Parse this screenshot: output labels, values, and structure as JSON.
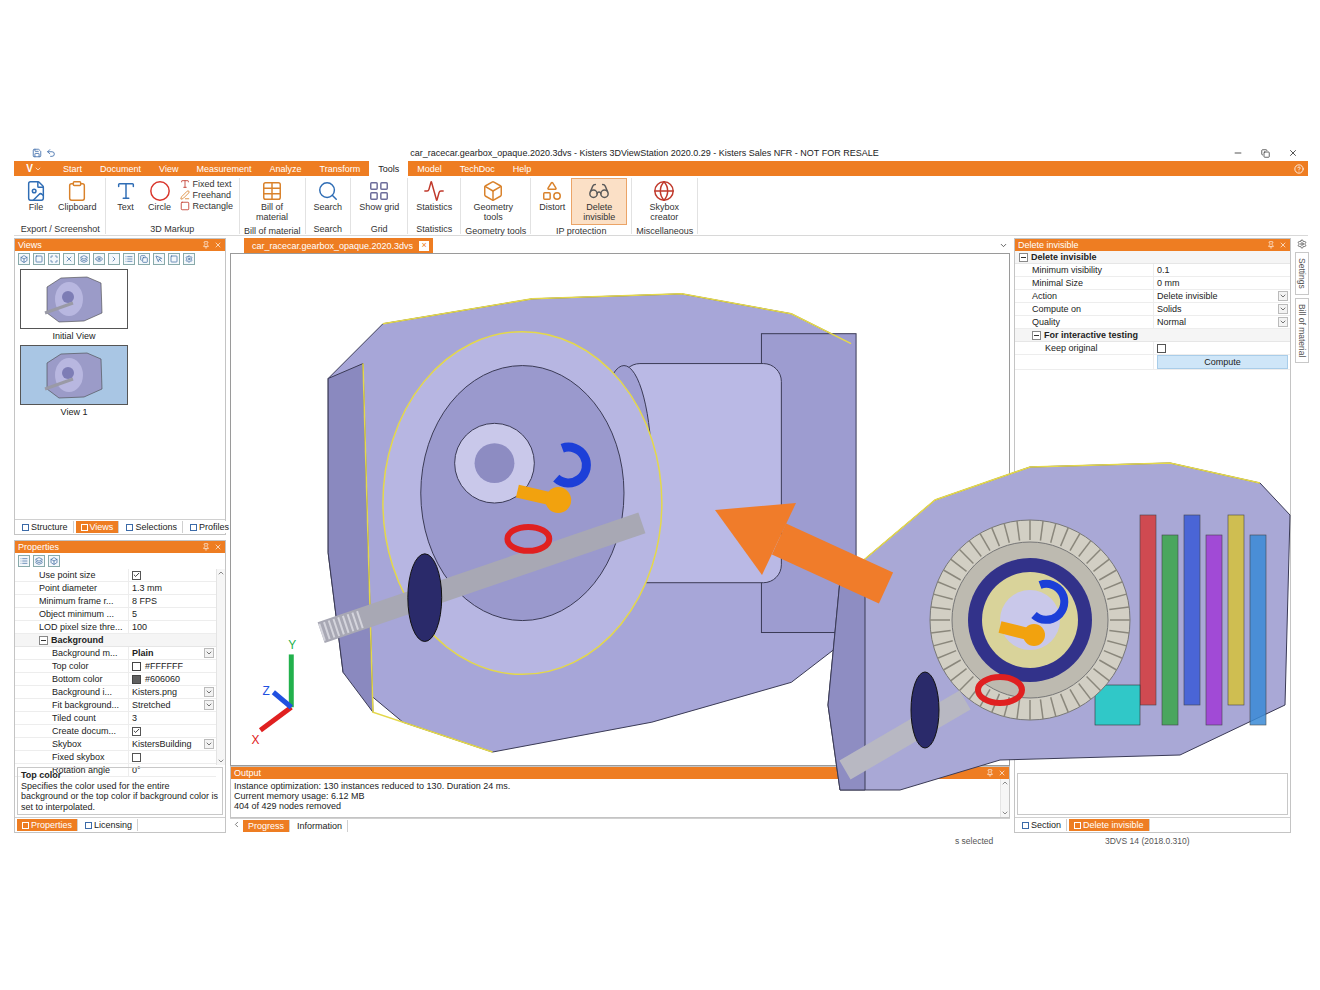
{
  "window": {
    "title": "car_racecar.gearbox_opaque.2020.3dvs - Kisters 3DViewStation 2020.0.29 - Kisters Sales NFR - NOT FOR RESALE"
  },
  "menu": {
    "app_button": "V",
    "tabs": [
      {
        "label": "Start",
        "selected": false
      },
      {
        "label": "Document",
        "selected": false
      },
      {
        "label": "View",
        "selected": false
      },
      {
        "label": "Measurement",
        "selected": false
      },
      {
        "label": "Analyze",
        "selected": false
      },
      {
        "label": "Transform",
        "selected": false
      },
      {
        "label": "Tools",
        "selected": true
      },
      {
        "label": "Model",
        "selected": false
      },
      {
        "label": "TechDoc",
        "selected": false
      },
      {
        "label": "Help",
        "selected": false
      }
    ]
  },
  "ribbon": {
    "groups": [
      {
        "label": "Export / Screenshot",
        "buttons": [
          {
            "label": "File",
            "kind": "large",
            "selected": false
          },
          {
            "label": "Clipboard",
            "kind": "large",
            "selected": false
          }
        ]
      },
      {
        "label": "3D Markup",
        "buttons": [
          {
            "label": "Text",
            "kind": "large",
            "selected": false
          },
          {
            "label": "Circle",
            "kind": "large",
            "selected": false
          },
          {
            "label": "Fixed text",
            "kind": "small",
            "selected": false
          },
          {
            "label": "Freehand",
            "kind": "small",
            "selected": false
          },
          {
            "label": "Rectangle",
            "kind": "small",
            "selected": false
          }
        ]
      },
      {
        "label": "Bill of material",
        "buttons": [
          {
            "label": "Bill of material",
            "kind": "large",
            "selected": false
          }
        ]
      },
      {
        "label": "Search",
        "buttons": [
          {
            "label": "Search",
            "kind": "large",
            "selected": false
          }
        ]
      },
      {
        "label": "Grid",
        "buttons": [
          {
            "label": "Show grid",
            "kind": "large",
            "selected": false
          }
        ]
      },
      {
        "label": "Statistics",
        "buttons": [
          {
            "label": "Statistics",
            "kind": "large",
            "selected": false
          }
        ]
      },
      {
        "label": "Geometry tools",
        "buttons": [
          {
            "label": "Geometry tools",
            "kind": "large",
            "selected": false
          }
        ]
      },
      {
        "label": "IP protection",
        "buttons": [
          {
            "label": "Distort",
            "kind": "large",
            "selected": false
          },
          {
            "label": "Delete invisible",
            "kind": "large",
            "selected": true
          }
        ]
      },
      {
        "label": "Miscellaneous",
        "buttons": [
          {
            "label": "Skybox creator",
            "kind": "large",
            "selected": false
          }
        ]
      }
    ]
  },
  "views_panel": {
    "title": "Views",
    "thumbnails": [
      {
        "label": "Initial View",
        "selected": false
      },
      {
        "label": "View 1",
        "selected": true
      }
    ],
    "tabs": [
      {
        "label": "Structure",
        "selected": false
      },
      {
        "label": "Views",
        "selected": true
      },
      {
        "label": "Selections",
        "selected": false
      },
      {
        "label": "Profiles",
        "selected": false
      }
    ]
  },
  "properties_panel": {
    "title": "Properties",
    "rows": [
      {
        "kind": "checkbox",
        "label": "Use point size",
        "checked": true
      },
      {
        "kind": "text",
        "label": "Point diameter",
        "value": "1.3 mm"
      },
      {
        "kind": "text",
        "label": "Minimum frame r...",
        "value": "8 FPS"
      },
      {
        "kind": "text",
        "label": "Object minimum ...",
        "value": "5"
      },
      {
        "kind": "text",
        "label": "LOD pixel size thre...",
        "value": "100"
      },
      {
        "kind": "group",
        "label": "Background",
        "expanded": true,
        "children": [
          {
            "kind": "dropdown",
            "label": "Background m...",
            "value": "Plain",
            "modified": true
          },
          {
            "kind": "color",
            "label": "Top color",
            "value": "#FFFFFF",
            "color": "#ffffff"
          },
          {
            "kind": "color",
            "label": "Bottom color",
            "value": "#606060",
            "color": "#606060"
          },
          {
            "kind": "dropdown",
            "label": "Background i...",
            "value": "Kisters.png",
            "modified": false
          },
          {
            "kind": "dropdown",
            "label": "Fit background...",
            "value": "Stretched",
            "modified": false
          },
          {
            "kind": "text",
            "label": "Tiled count",
            "value": "3"
          },
          {
            "kind": "checkbox",
            "label": "Create docum...",
            "checked": true
          },
          {
            "kind": "dropdown",
            "label": "Skybox",
            "value": "KistersBuilding",
            "modified": false
          },
          {
            "kind": "checkbox",
            "label": "Fixed skybox",
            "checked": false
          },
          {
            "kind": "text",
            "label": "Rotation angle",
            "value": "0°"
          }
        ]
      }
    ],
    "description": {
      "title": "Top color",
      "text": "Specifies the color used for the entire background or the top color if background color is set to interpolated."
    },
    "tabs": [
      {
        "label": "Properties",
        "selected": true
      },
      {
        "label": "Licensing",
        "selected": false
      }
    ]
  },
  "document": {
    "tab": "car_racecar.gearbox_opaque.2020.3dvs",
    "close": "×"
  },
  "axes": [
    {
      "label": "X",
      "color": "#e02020"
    },
    {
      "label": "Y",
      "color": "#22b14c"
    },
    {
      "label": "Z",
      "color": "#2050e0"
    }
  ],
  "output": {
    "title": "Output",
    "lines": [
      "Instance optimization: 130 instances reduced to 130. Duration 24 ms.",
      "Current memory usage: 6.12 MB",
      "404 of 429 nodes removed"
    ],
    "tabs": [
      {
        "label": "Progress",
        "selected": true
      },
      {
        "label": "Information",
        "selected": false
      }
    ]
  },
  "status_bar": {
    "selection": "s selected",
    "version": "3DVS 14 (2018.0.310)"
  },
  "delete_panel": {
    "title": "Delete invisible",
    "rows": [
      {
        "kind": "group",
        "label": "Delete invisible",
        "expanded": true,
        "children": [
          {
            "kind": "text",
            "label": "Minimum visibility",
            "value": "0.1"
          },
          {
            "kind": "text",
            "label": "Minimal Size",
            "value": "0 mm"
          },
          {
            "kind": "dropdown",
            "label": "Action",
            "value": "Delete invisible",
            "modified": false
          },
          {
            "kind": "dropdown",
            "label": "Compute on",
            "value": "Solids",
            "modified": false
          },
          {
            "kind": "dropdown",
            "label": "Quality",
            "value": "Normal",
            "modified": false
          },
          {
            "kind": "group",
            "label": "For interactive testing",
            "expanded": true,
            "children": [
              {
                "kind": "checkbox",
                "label": "Keep original",
                "checked": false
              },
              {
                "kind": "button",
                "label": "",
                "value": "Compute"
              }
            ]
          }
        ]
      }
    ],
    "tabs": [
      {
        "label": "Section",
        "selected": false
      },
      {
        "label": "Delete invisible",
        "selected": true
      }
    ]
  },
  "side_tabs": [
    {
      "label": "Settings",
      "selected": false
    },
    {
      "label": "Bill of material",
      "selected": false
    }
  ]
}
